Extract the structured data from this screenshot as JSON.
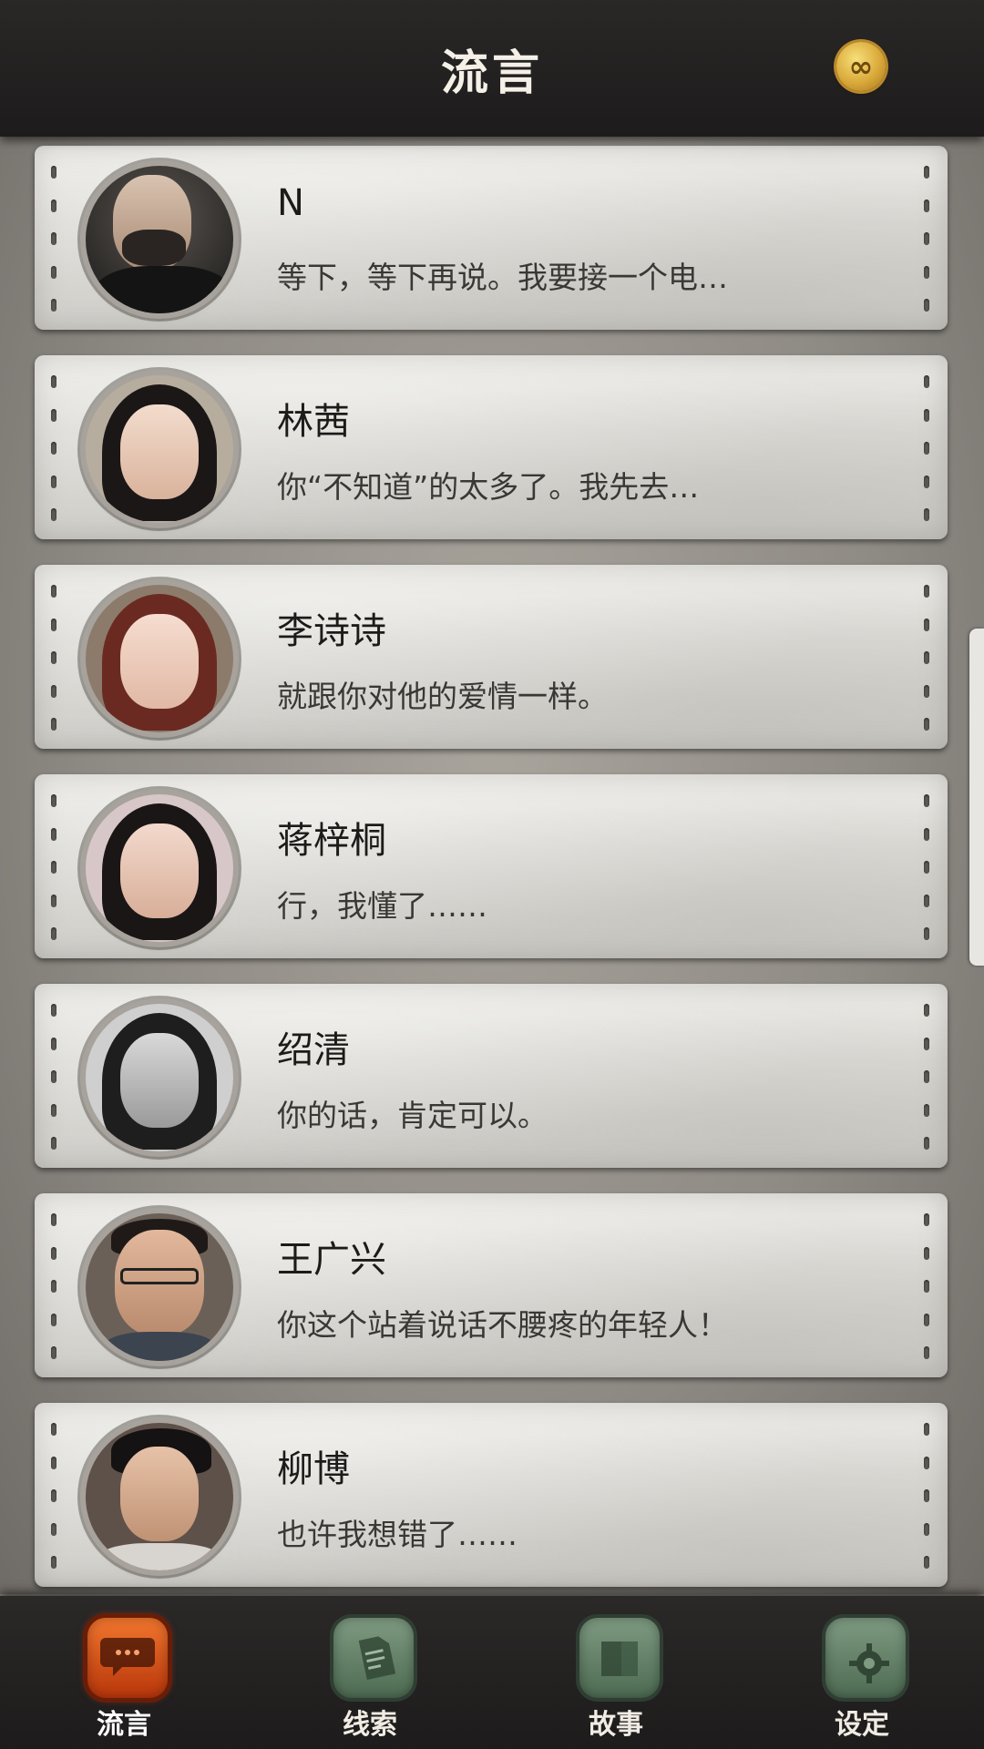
{
  "header": {
    "title": "流言",
    "coin_icon": "infinity-coin-icon",
    "coin_symbol": "∞"
  },
  "messages": [
    {
      "name": "N",
      "preview": "等下，等下再说。我要接一个电…",
      "avatar": "man-bearded"
    },
    {
      "name": "林茜",
      "preview": "你“不知道”的太多了。我先去…",
      "avatar": "woman-long-hair"
    },
    {
      "name": "李诗诗",
      "preview": "就跟你对他的爱情一样。",
      "avatar": "woman-reddish-hair"
    },
    {
      "name": "蒋梓桐",
      "preview": "行，我懂了……",
      "avatar": "woman-dark-hair"
    },
    {
      "name": "绍清",
      "preview": "你的话，肯定可以。",
      "avatar": "woman-grayscale"
    },
    {
      "name": "王广兴",
      "preview": "你这个站着说话不腰疼的年轻人！",
      "avatar": "man-glasses"
    },
    {
      "name": "柳博",
      "preview": "也许我想错了……",
      "avatar": "man-young"
    }
  ],
  "tabs": [
    {
      "label": "流言",
      "icon": "chat-bubble-icon",
      "active": true
    },
    {
      "label": "线索",
      "icon": "document-icon",
      "active": false
    },
    {
      "label": "故事",
      "icon": "book-icon",
      "active": false
    },
    {
      "label": "设定",
      "icon": "gear-icon",
      "active": false
    }
  ],
  "colors": {
    "header_bg": "#1d1b1b",
    "card_bg": "#e2e1dc",
    "active_tab": "#e0561a",
    "inactive_tab": "#5f7f64"
  }
}
